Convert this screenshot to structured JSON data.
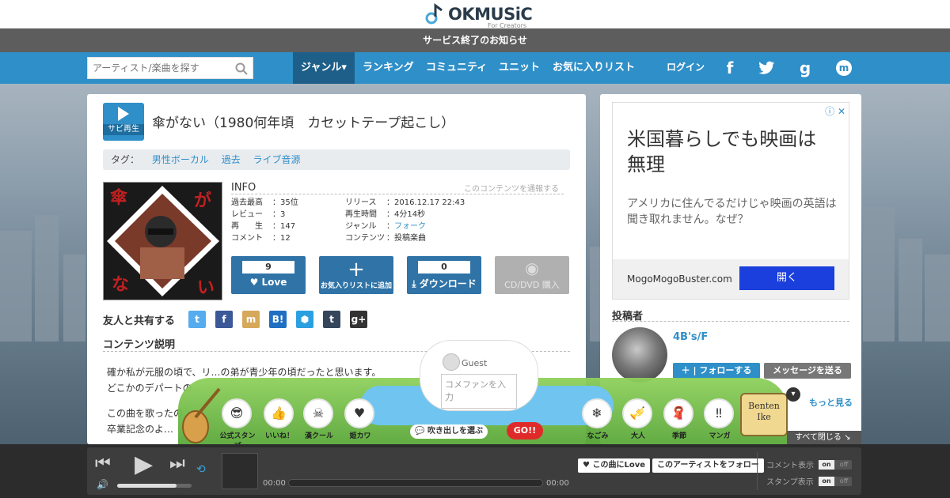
{
  "header": {
    "logo_text": "OKMUSiC",
    "logo_sub": "For Creators",
    "notice": "サービス終了のお知らせ"
  },
  "nav": {
    "search_placeholder": "アーティスト/楽曲を探す",
    "items": [
      "ジャンル▾",
      "ランキング",
      "コミュニティ",
      "ユニット",
      "お気に入りリスト"
    ],
    "login": "ログイン"
  },
  "song": {
    "sabi_label": "サビ再生",
    "title": "傘がない（1980何年頃　カセットテープ起こし）",
    "tags_label": "タグ：",
    "tags": [
      "男性ボーカル",
      "過去",
      "ライブ音源"
    ],
    "jacket_chars": [
      "傘",
      "が",
      "な",
      "い"
    ]
  },
  "info": {
    "heading": "INFO",
    "report": "このコンテンツを通報する",
    "left": [
      {
        "k": "過去最高",
        "v": "35位"
      },
      {
        "k": "レビュー",
        "v": "3"
      },
      {
        "k": "再　　生",
        "v": "147"
      },
      {
        "k": "コメント",
        "v": "12"
      }
    ],
    "right": [
      {
        "k": "リリース",
        "v": "2016.12.17 22:43"
      },
      {
        "k": "再生時間",
        "v": "4分14秒"
      },
      {
        "k": "ジャンル",
        "v": "フォーク"
      },
      {
        "k": "コンテンツ",
        "v": "投稿楽曲"
      }
    ]
  },
  "actions": {
    "love_count": "9",
    "love_label": "Love",
    "fav_label": "お気入りリストに追加",
    "dl_count": "0",
    "dl_label": "ダウンロード",
    "cd_label": "CD/DVD 購入"
  },
  "share": {
    "title": "友人と共有する"
  },
  "description": {
    "title": "コンテンツ説明",
    "line1": "確か私が元服の頃で、リ…の弟が青少年の頃だったと思います。",
    "line2": "どこかのデパートの…",
    "line3": "この曲を歌ったの…",
    "line4": "卒業記念のよ…"
  },
  "ad": {
    "close": "ⓘ ✕",
    "headline": "米国暮らしでも映画は無理",
    "body": "アメリカに住んでるだけじゃ映画の英語は聞き取れません。なぜ？",
    "source": "MogoMogoBuster.com",
    "cta": "開く"
  },
  "poster": {
    "title": "投稿者",
    "name": "4B's/F",
    "follow": "フォローする",
    "message": "メッセージを送る",
    "more": "もっと見る"
  },
  "stamps": {
    "guest": "Guest",
    "comment_placeholder": "コメファンを入力",
    "bubble_choose": "吹き出しを選ぶ",
    "go": "GO!!",
    "labels": [
      "公式スタンプ",
      "いいね！",
      "漢クール",
      "姫カワ",
      "なごみ",
      "大人",
      "季節",
      "マンガ"
    ],
    "benten": "Benten Ike",
    "close_all": "すべて閉じる"
  },
  "player": {
    "time_start": "00:00",
    "time_end": "00:00",
    "love_btn": "この曲にLove",
    "follow_btn": "このアーティストをフォロー",
    "comment_display": "コメント表示",
    "stamp_display": "スタンプ表示",
    "on": "on",
    "off": "off",
    "volume": 0.8
  }
}
